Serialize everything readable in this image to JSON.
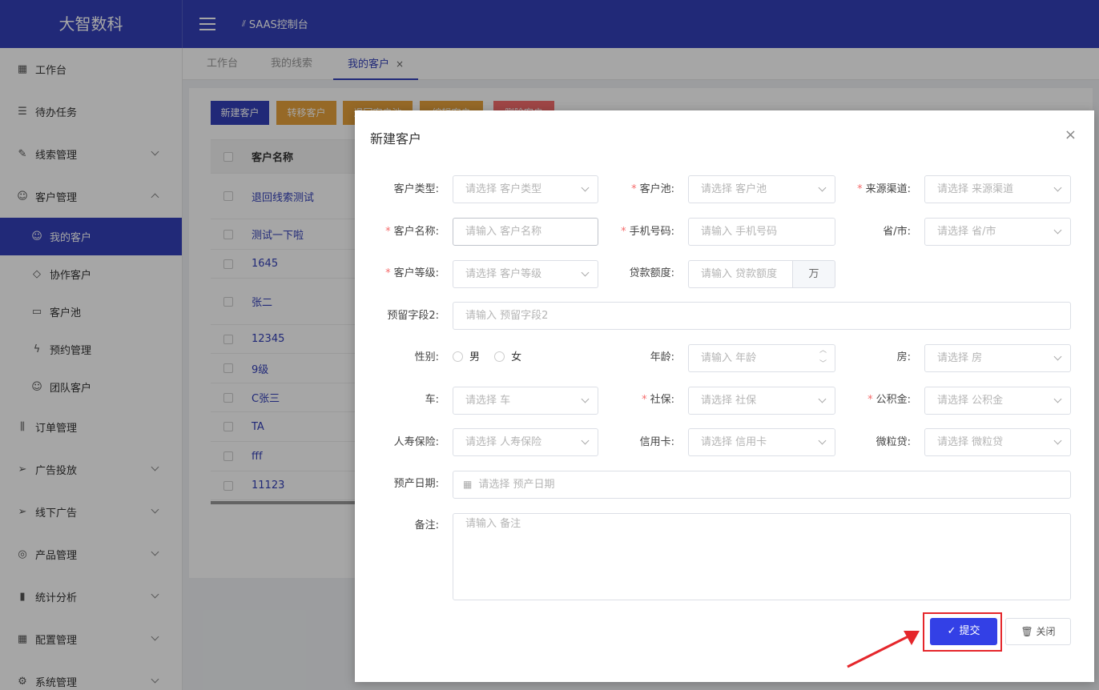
{
  "app": {
    "logo": "大智数科",
    "console": "SAAS控制台"
  },
  "sidebar": {
    "items": [
      {
        "label": "工作台",
        "icon": "dashboard-icon"
      },
      {
        "label": "待办任务",
        "icon": "task-icon"
      },
      {
        "label": "线索管理",
        "icon": "edit-icon"
      },
      {
        "label": "客户管理",
        "icon": "user-icon"
      },
      {
        "label": "订单管理",
        "icon": "order-icon"
      },
      {
        "label": "广告投放",
        "icon": "send-icon"
      },
      {
        "label": "线下广告",
        "icon": "send-icon"
      },
      {
        "label": "产品管理",
        "icon": "product-icon"
      },
      {
        "label": "统计分析",
        "icon": "chart-icon"
      },
      {
        "label": "配置管理",
        "icon": "grid-icon"
      },
      {
        "label": "系统管理",
        "icon": "settings-icon"
      }
    ],
    "sub": [
      {
        "label": "我的客户"
      },
      {
        "label": "协作客户"
      },
      {
        "label": "客户池"
      },
      {
        "label": "预约管理"
      },
      {
        "label": "团队客户"
      }
    ]
  },
  "tabs": [
    {
      "label": "工作台"
    },
    {
      "label": "我的线索"
    },
    {
      "label": "我的客户"
    }
  ],
  "toolbar": {
    "new_customer": "新建客户",
    "transfer": "转移客户",
    "btn3": "退回客户池",
    "btn4": "编辑客户",
    "btn5": "删除客户"
  },
  "table": {
    "header": "客户名称",
    "rows": [
      "退回线索测试",
      "测试一下啦",
      "1645",
      "张二",
      "12345",
      "9级",
      "C张三",
      "TA",
      "fff",
      "11123"
    ]
  },
  "modal": {
    "title": "新建客户",
    "fields": {
      "customer_type": {
        "label": "客户类型:",
        "placeholder": "请选择 客户类型"
      },
      "pool": {
        "label": "客户池:",
        "placeholder": "请选择 客户池"
      },
      "source": {
        "label": "来源渠道:",
        "placeholder": "请选择 来源渠道"
      },
      "name": {
        "label": "客户名称:",
        "placeholder": "请输入 客户名称"
      },
      "phone": {
        "label": "手机号码:",
        "placeholder": "请输入 手机号码"
      },
      "province": {
        "label": "省/市:",
        "placeholder": "请选择 省/市"
      },
      "level": {
        "label": "客户等级:",
        "placeholder": "请选择 客户等级"
      },
      "loan": {
        "label": "贷款额度:",
        "placeholder": "请输入 贷款额度",
        "unit": "万"
      },
      "reserve2": {
        "label": "预留字段2:",
        "placeholder": "请输入 预留字段2"
      },
      "gender": {
        "label": "性别:",
        "options": [
          "男",
          "女"
        ]
      },
      "age": {
        "label": "年龄:",
        "placeholder": "请输入 年龄"
      },
      "house": {
        "label": "房:",
        "placeholder": "请选择 房"
      },
      "car": {
        "label": "车:",
        "placeholder": "请选择 车"
      },
      "social": {
        "label": "社保:",
        "placeholder": "请选择 社保"
      },
      "fund": {
        "label": "公积金:",
        "placeholder": "请选择 公积金"
      },
      "insurance": {
        "label": "人寿保险:",
        "placeholder": "请选择 人寿保险"
      },
      "credit": {
        "label": "信用卡:",
        "placeholder": "请选择 信用卡"
      },
      "weili": {
        "label": "微粒贷:",
        "placeholder": "请选择 微粒贷"
      },
      "due_date": {
        "label": "预产日期:",
        "placeholder": "请选择 预产日期"
      },
      "remark": {
        "label": "备注:",
        "placeholder": "请输入 备注"
      }
    },
    "submit": "提交",
    "close": "关闭"
  },
  "colors": {
    "primary": "#3340b8",
    "submit": "#3340e6",
    "highlight": "#e5262b",
    "required": "#f56c6c"
  }
}
